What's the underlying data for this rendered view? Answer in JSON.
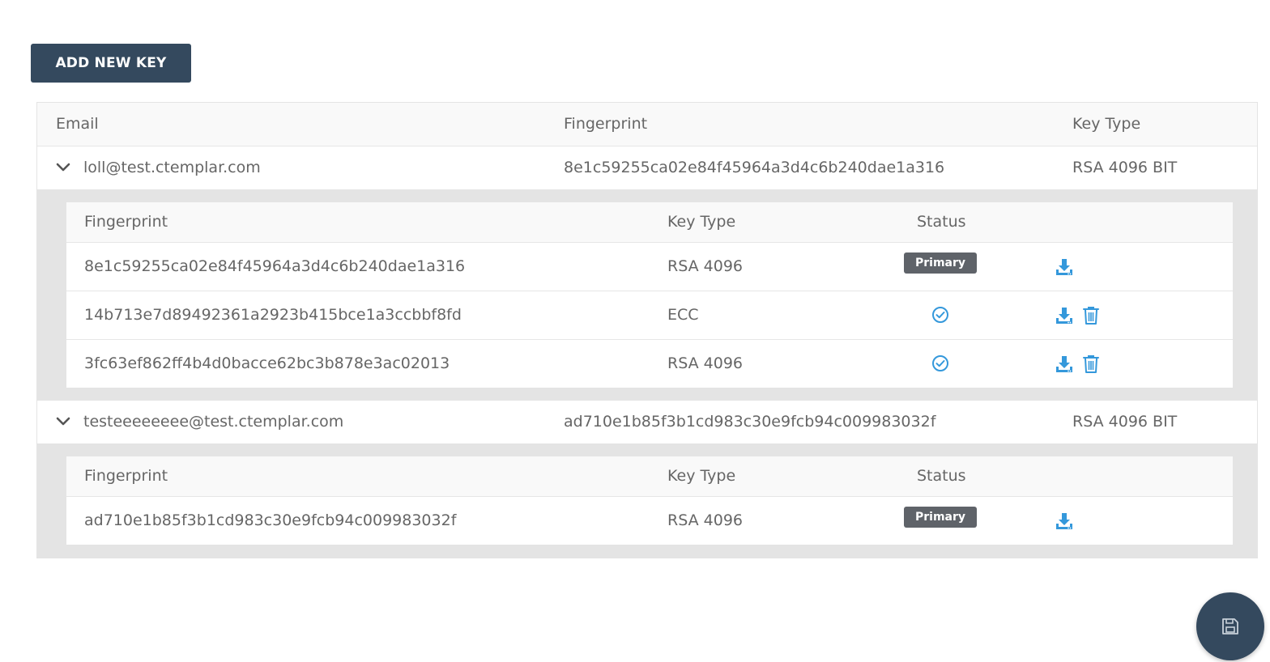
{
  "toolbar": {
    "add_key_label": "ADD NEW KEY"
  },
  "table": {
    "headers": {
      "email": "Email",
      "fingerprint": "Fingerprint",
      "key_type": "Key Type"
    },
    "sub_headers": {
      "fingerprint": "Fingerprint",
      "key_type": "Key Type",
      "status": "Status"
    },
    "groups": [
      {
        "email": "loll@test.ctemplar.com",
        "fingerprint": "8e1c59255ca02e84f45964a3d4c6b240dae1a316",
        "key_type": "RSA 4096 BIT",
        "keys": [
          {
            "fingerprint": "8e1c59255ca02e84f45964a3d4c6b240dae1a316",
            "key_type": "RSA 4096",
            "status": "Primary"
          },
          {
            "fingerprint": "14b713e7d89492361a2923b415bce1a3ccbbf8fd",
            "key_type": "ECC",
            "status": "check-circle-icon"
          },
          {
            "fingerprint": "3fc63ef862ff4b4d0bacce62bc3b878e3ac02013",
            "key_type": "RSA 4096",
            "status": "check-circle-icon"
          }
        ]
      },
      {
        "email": "testeeeeeeee@test.ctemplar.com",
        "fingerprint": "ad710e1b85f3b1cd983c30e9fcb94c009983032f",
        "key_type": "RSA 4096 BIT",
        "keys": [
          {
            "fingerprint": "ad710e1b85f3b1cd983c30e9fcb94c009983032f",
            "key_type": "RSA 4096",
            "status": "Primary"
          }
        ]
      }
    ]
  },
  "colors": {
    "primary_dark": "#34495e",
    "icon_blue": "#3498db",
    "badge_gray": "#5f6369"
  },
  "fab": {
    "icon": "save-icon"
  }
}
